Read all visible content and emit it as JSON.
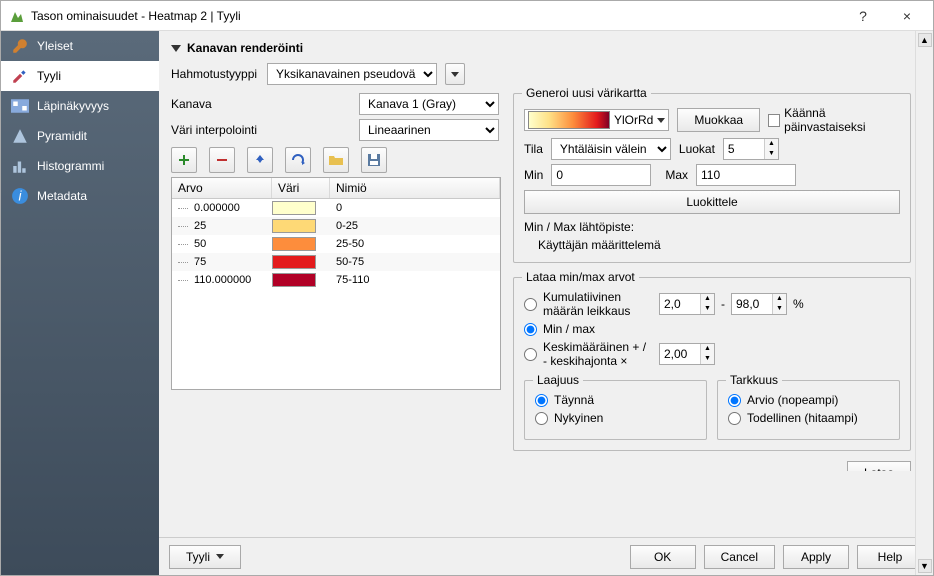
{
  "window": {
    "title": "Tason ominaisuudet - Heatmap 2 | Tyyli",
    "help": "?",
    "close": "×"
  },
  "sidebar": {
    "items": [
      {
        "label": "Yleiset"
      },
      {
        "label": "Tyyli"
      },
      {
        "label": "Läpinäkyvyys"
      },
      {
        "label": "Pyramidit"
      },
      {
        "label": "Histogrammi"
      },
      {
        "label": "Metadata"
      }
    ]
  },
  "section": {
    "title": "Kanavan renderöinti"
  },
  "render": {
    "type_label": "Hahmotustyyppi",
    "type_value": "Yksikanavainen pseudoväri",
    "channel_label": "Kanava",
    "channel_value": "Kanava 1 (Gray)",
    "interp_label": "Väri interpolointi",
    "interp_value": "Lineaarinen"
  },
  "table": {
    "headers": {
      "value": "Arvo",
      "color": "Väri",
      "label": "Nimiö"
    },
    "rows": [
      {
        "value": "0.000000",
        "color": "#ffffcc",
        "label": "0"
      },
      {
        "value": "25",
        "color": "#fed976",
        "label": "0-25"
      },
      {
        "value": "50",
        "color": "#fd8d3c",
        "label": "25-50"
      },
      {
        "value": "75",
        "color": "#e31a1c",
        "label": "50-75"
      },
      {
        "value": "110.000000",
        "color": "#b10026",
        "label": "75-110"
      }
    ]
  },
  "generate": {
    "legend": "Generoi uusi värikartta",
    "ramp_name": "YlOrRd",
    "edit": "Muokkaa",
    "invert": "Käännä päinvastaiseksi",
    "mode_label": "Tila",
    "mode_value": "Yhtäläisin välein",
    "classes_label": "Luokat",
    "classes_value": "5",
    "min_label": "Min",
    "min_value": "0",
    "max_label": "Max",
    "max_value": "110",
    "classify": "Luokittele",
    "origin_label": "Min / Max lähtöpiste:",
    "origin_value": "Käyttäjän määrittelemä"
  },
  "load": {
    "legend": "Lataa min/max arvot",
    "cumulative": "Kumulatiivinen määrän leikkaus",
    "cum_low": "2,0",
    "cum_high": "98,0",
    "percent": "%",
    "minmax": "Min / max",
    "stddev": "Keskimääräinen + / - keskihajonta ×",
    "stddev_value": "2,00",
    "extent_legend": "Laajuus",
    "extent_full": "Täynnä",
    "extent_current": "Nykyinen",
    "accuracy_legend": "Tarkkuus",
    "accuracy_estimate": "Arvio (nopeampi)",
    "accuracy_actual": "Todellinen (hitaampi)"
  },
  "footer": {
    "style": "Tyyli",
    "ok": "OK",
    "cancel": "Cancel",
    "apply": "Apply",
    "help": "Help",
    "lataa": "Lataa"
  }
}
